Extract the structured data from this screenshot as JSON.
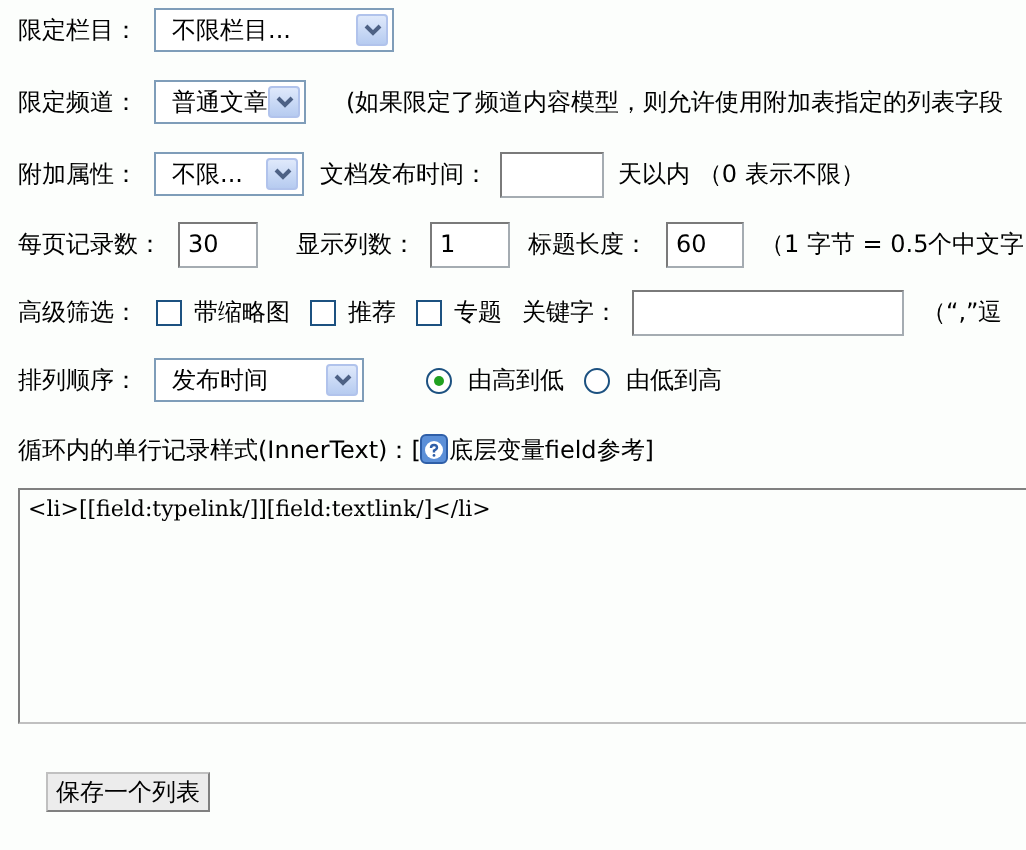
{
  "category": {
    "label": "限定栏目：",
    "value": "不限栏目..."
  },
  "channel": {
    "label": "限定频道：",
    "value": "普通文章",
    "note": "(如果限定了频道内容模型，则允许使用附加表指定的列表字段"
  },
  "attributes": {
    "label": "附加属性：",
    "value": "不限...",
    "date_label": "文档发布时间：",
    "date_suffix": "天以内 （0 表示不限）"
  },
  "paging": {
    "per_page_label": "每页记录数：",
    "per_page": "30",
    "columns_label": "显示列数：",
    "columns": "1",
    "title_length_label": "标题长度：",
    "title_length": "60",
    "note": "（1 字节 = 0.5个中文字"
  },
  "filters": {
    "label": "高级筛选：",
    "options": [
      {
        "label": "带缩略图",
        "checked": false
      },
      {
        "label": "推荐",
        "checked": false
      },
      {
        "label": "专题",
        "checked": false
      }
    ],
    "keyword_label": "关键字：",
    "note": "（“,”逗"
  },
  "sort": {
    "label": "排列顺序：",
    "value": "发布时间",
    "options": [
      {
        "label": "由高到低",
        "selected": true
      },
      {
        "label": "由低到高",
        "selected": false
      }
    ]
  },
  "template": {
    "label": "循环内的单行记录样式(InnerText)：[",
    "link": "底层变量field参考",
    "close": "]",
    "value": "<li>[[field:typelink/]][field:textlink/]</li>"
  },
  "save_button": "保存一个列表"
}
